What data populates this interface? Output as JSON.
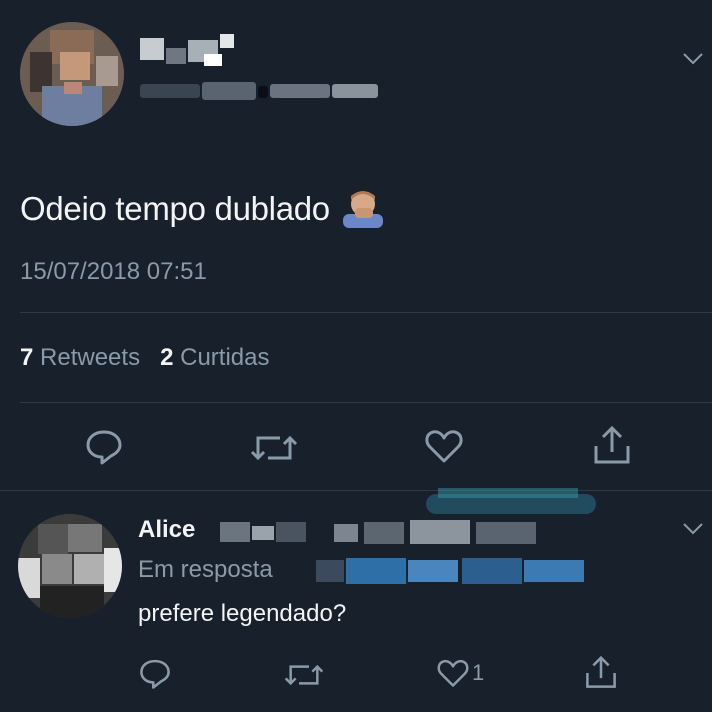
{
  "tweet": {
    "text": "Odeio tempo dublado",
    "emoji": "🤦🏼‍♂️",
    "timestamp": "15/07/2018 07:51",
    "retweets_count": "7",
    "retweets_label": "Retweets",
    "likes_count": "2",
    "likes_label": "Curtidas"
  },
  "reply": {
    "name": "Alice",
    "in_reply_to": "Em resposta",
    "text": "prefere legendado?",
    "like_count": "1"
  },
  "icons": [
    "reply-icon",
    "retweet-icon",
    "like-icon",
    "share-icon",
    "chevron-down-icon"
  ],
  "colors": {
    "background": "#17202b",
    "muted": "#8a9aa8",
    "text": "#f2f4f6"
  }
}
